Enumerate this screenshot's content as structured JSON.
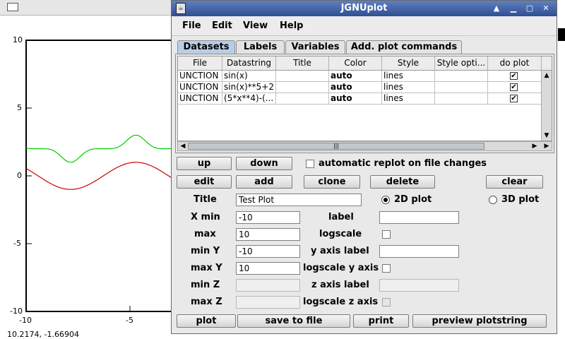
{
  "plot_window": {
    "coordinate_readout": "10.2174,  -1.66904",
    "y_ticks": [
      "10",
      "5",
      "0",
      "-5",
      "-10"
    ],
    "x_ticks": [
      "-10",
      "-5"
    ],
    "series_colors": {
      "sin_x": "#cc0000",
      "sin_x_shifted": "#00cc00"
    }
  },
  "chart_data": {
    "type": "line",
    "xlim": [
      -10,
      10
    ],
    "ylim": [
      -10,
      10
    ],
    "x_ticks": [
      -10,
      -5
    ],
    "y_ticks": [
      10,
      5,
      0,
      -5,
      -10
    ],
    "series": [
      {
        "expression": "sin(x)",
        "color": "#cc0000"
      },
      {
        "expression": "sin(x)**5+2",
        "color": "#00cc00"
      }
    ]
  },
  "window": {
    "title": "JGNUplot",
    "icon": "java-cup-icon",
    "controls": [
      "pin-icon",
      "minimize-icon",
      "maximize-icon",
      "close-icon"
    ]
  },
  "menu": [
    "File",
    "Edit",
    "View",
    "Help"
  ],
  "tabs": [
    "Datasets",
    "Labels",
    "Variables",
    "Add. plot commands"
  ],
  "table": {
    "columns": [
      "File",
      "Datastring",
      "Title",
      "Color",
      "Style",
      "Style opti...",
      "do plot"
    ],
    "rows": [
      {
        "file": "UNCTION",
        "datastring": "sin(x)",
        "title": "",
        "color": "auto",
        "style": "lines",
        "style_options": "",
        "do_plot": true
      },
      {
        "file": "UNCTION",
        "datastring": "sin(x)**5+2",
        "title": "",
        "color": "auto",
        "style": "lines",
        "style_options": "",
        "do_plot": true
      },
      {
        "file": "UNCTION",
        "datastring": "(5*x**4)-(...",
        "title": "",
        "color": "auto",
        "style": "lines",
        "style_options": "",
        "do_plot": true
      }
    ]
  },
  "buttons": {
    "up": "up",
    "down": "down",
    "edit": "edit",
    "add": "add",
    "clone": "clone",
    "delete": "delete",
    "clear": "clear",
    "plot": "plot",
    "save": "save to file",
    "print": "print",
    "preview": "preview plotstring"
  },
  "auto_replot": {
    "label": "automatic replot on file changes",
    "checked": false
  },
  "form": {
    "title_label": "Title",
    "title_value": "Test Plot",
    "xmin_label": "X min",
    "xmin_value": "-10",
    "xmax_label": "max",
    "xmax_value": "10",
    "ymin_label": "min Y",
    "ymin_value": "-10",
    "ymax_label": "max Y",
    "ymax_value": "10",
    "zmin_label": "min Z",
    "zmin_value": "",
    "zmax_label": "max Z",
    "zmax_value": "",
    "xlabel_label": "label",
    "xlabel_value": "",
    "logscale_label": "logscale",
    "ylabel_label": "y axis label",
    "ylabel_value": "",
    "logscale_y_label": "logscale y axis",
    "zlabel_label": "z axis label",
    "zlabel_value": "",
    "logscale_z_label": "logscale z axis",
    "plot2d_label": "2D plot",
    "plot3d_label": "3D plot",
    "plot_mode": "2D"
  }
}
